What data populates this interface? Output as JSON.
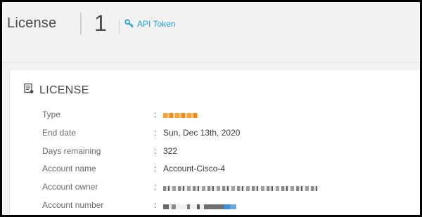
{
  "header": {
    "title": "License",
    "count": "1",
    "api_token_label": "API Token"
  },
  "license": {
    "section_title": "LICENSE",
    "rows": [
      {
        "label": "Type",
        "value": ""
      },
      {
        "label": "End date",
        "value": "Sun, Dec 13th, 2020"
      },
      {
        "label": "Days remaining",
        "value": "322"
      },
      {
        "label": "Account name",
        "value": "Account-Cisco-4"
      },
      {
        "label": "Account owner",
        "value": ""
      },
      {
        "label": "Account number",
        "value": ""
      }
    ],
    "separator": ":"
  },
  "icons": {
    "api_token": "key-icon",
    "section": "license-document-icon"
  },
  "colors": {
    "accent": "#1fa0d6",
    "background": "#f2f2f2",
    "card": "#ffffff",
    "text": "#4a4a4a"
  }
}
